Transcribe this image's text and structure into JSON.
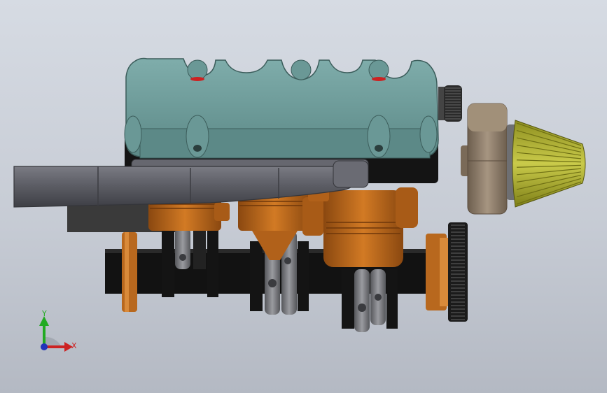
{
  "viewport": {
    "background_top": "#d6dbe3",
    "background_bottom": "#b4b9c3"
  },
  "model": {
    "parts": [
      "valve-cover",
      "cam-pulley",
      "exhaust-manifold",
      "pistons",
      "connecting-rods",
      "crankshaft",
      "flywheel",
      "timing-pulley",
      "turbo-housing",
      "air-filter"
    ],
    "colors": {
      "valve_cover": "#6f9d9b",
      "valve_cover_dark": "#4f7775",
      "head_block": "#141414",
      "exhaust": "#5f6068",
      "piston": "#c06a1c",
      "piston_dark": "#8a4810",
      "rod": "#77787c",
      "crank": "#111111",
      "pulley": "#1b1b1b",
      "turbo": "#8d7c69",
      "air_filter": "#b3b436",
      "marker_red": "#cc2222"
    }
  },
  "triad": {
    "x_label": "X",
    "y_label": "Y",
    "x_color": "#cc2222",
    "y_color": "#22aa22",
    "z_color": "#2233bb"
  }
}
